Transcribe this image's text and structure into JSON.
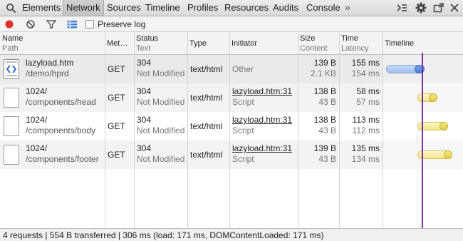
{
  "tabs": [
    {
      "label": "Elements",
      "selected": false
    },
    {
      "label": "Network",
      "selected": true
    },
    {
      "label": "Sources",
      "selected": false
    },
    {
      "label": "Timeline",
      "selected": false
    },
    {
      "label": "Profiles",
      "selected": false
    },
    {
      "label": "Resources",
      "selected": false
    },
    {
      "label": "Audits",
      "selected": false
    },
    {
      "label": "Console",
      "selected": false
    }
  ],
  "tabs_more": "»",
  "toolbar": {
    "preserve_log_label": "Preserve log",
    "preserve_log_checked": false,
    "record_color": "#e0302b",
    "filter_active_color": "#3a78d6"
  },
  "columns": {
    "name": "Name",
    "path": "Path",
    "method": "Met…",
    "status": "Status",
    "text": "Text",
    "type": "Type",
    "initiator": "Initiator",
    "size": "Size",
    "content": "Content",
    "time": "Time",
    "latency": "Latency",
    "timeline": "Timeline"
  },
  "requests": [
    {
      "name": "lazyload.htm",
      "path": "/demo/hprd",
      "method": "GET",
      "status": "304",
      "status_text": "Not Modified",
      "type": "text/html",
      "initiator": "Other",
      "initiator_sub": "",
      "size": "139 B",
      "content": "2.1 KB",
      "time": "155 ms",
      "latency": "154 ms",
      "icon": "html-file-icon"
    },
    {
      "name": "1024/",
      "path": "/components/head",
      "method": "GET",
      "status": "304",
      "status_text": "Not Modified",
      "type": "text/html",
      "initiator": "lazyload.htm:31",
      "initiator_sub": "Script",
      "size": "138 B",
      "content": "43 B",
      "time": "58 ms",
      "latency": "57 ms",
      "icon": "blank-file-icon"
    },
    {
      "name": "1024/",
      "path": "/components/body",
      "method": "GET",
      "status": "304",
      "status_text": "Not Modified",
      "type": "text/html",
      "initiator": "lazyload.htm:31",
      "initiator_sub": "Script",
      "size": "138 B",
      "content": "43 B",
      "time": "113 ms",
      "latency": "112 ms",
      "icon": "blank-file-icon"
    },
    {
      "name": "1024/",
      "path": "/components/footer",
      "method": "GET",
      "status": "304",
      "status_text": "Not Modified",
      "type": "text/html",
      "initiator": "lazyload.htm:31",
      "initiator_sub": "Script",
      "size": "139 B",
      "content": "43 B",
      "time": "135 ms",
      "latency": "134 ms",
      "icon": "blank-file-icon"
    }
  ],
  "status_bar": "4 requests | 554 B transferred | 306 ms (load: 171 ms, DOMContentLoaded: 171 ms)",
  "colors": {
    "load_line": "#7a2ea8",
    "document_bar": "#4d7ed3",
    "script_bar": "#e1cd44"
  }
}
